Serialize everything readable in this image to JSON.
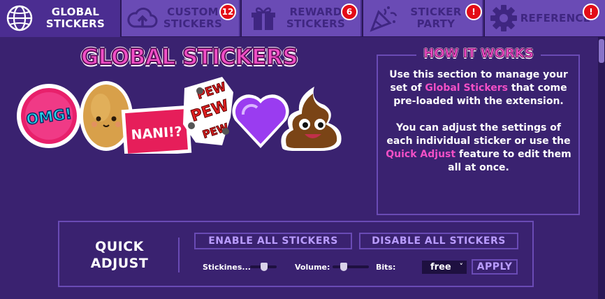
{
  "tabs": [
    {
      "id": "global",
      "label_line1": "GLOBAL",
      "label_line2": "STICKERS",
      "icon": "globe-icon",
      "active": true,
      "badge": ""
    },
    {
      "id": "custom",
      "label_line1": "CUSTOM",
      "label_line2": "STICKERS",
      "icon": "cloud-upload-icon",
      "active": false,
      "badge": "12"
    },
    {
      "id": "reward",
      "label_line1": "REWARD",
      "label_line2": "STICKERS",
      "icon": "gift-icon",
      "active": false,
      "badge": "6"
    },
    {
      "id": "party",
      "label_line1": "STICKER",
      "label_line2": "PARTY",
      "icon": "party-popper-icon",
      "active": false,
      "badge": "!"
    },
    {
      "id": "reference",
      "label_line1": "REFERENCE",
      "label_line2": "",
      "icon": "gear-icon",
      "active": false,
      "badge": "!"
    }
  ],
  "main": {
    "title": "GLOBAL STICKERS",
    "stickers": [
      {
        "name": "omg-sticker",
        "text": "OMG!"
      },
      {
        "name": "potato-sticker",
        "text": ""
      },
      {
        "name": "nani-sticker",
        "text": "NANI!?"
      },
      {
        "name": "pew-sticker",
        "text": "PEW PEW PEW"
      },
      {
        "name": "heart-sticker",
        "text": ""
      },
      {
        "name": "poop-sticker",
        "text": ""
      }
    ]
  },
  "how_it_works": {
    "title": "HOW IT WORKS",
    "p1_a": "Use this section to manage your set of ",
    "p1_hl": "Global Stickers",
    "p1_b": " that come pre-loaded with the extension.",
    "p2_a": "You can adjust the settings of each individual sticker or use the ",
    "p2_hl": "Quick Adjust",
    "p2_b": " feature to edit them all at once."
  },
  "quick_adjust": {
    "title_line1": "QUICK",
    "title_line2": "ADJUST",
    "enable_label": "ENABLE ALL STICKERS",
    "disable_label": "DISABLE ALL STICKERS",
    "stickiness_label": "Stickines...",
    "stickiness_value": 0.55,
    "volume_label": "Volume:",
    "volume_value": 0.25,
    "bits_label": "Bits:",
    "bits_selected": "free",
    "apply_label": "APPLY"
  },
  "colors": {
    "background": "#3a2270",
    "tab_inactive": "#6a4bb5",
    "tab_active": "#4b2d91",
    "accent_pink": "#f24fc6",
    "badge_red": "#e30c17",
    "button_text": "#b99cff"
  }
}
